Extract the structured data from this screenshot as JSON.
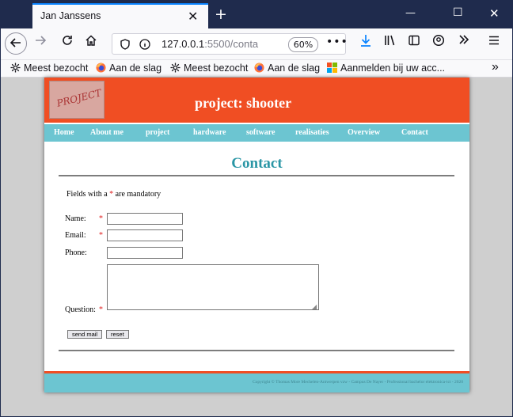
{
  "browser": {
    "tab_title": "Jan Janssens",
    "tab_close": "✕",
    "new_tab": "+",
    "window_controls": {
      "minimize": "—",
      "maximize": "☐",
      "close": "✕"
    },
    "url_host": "127.0.0.1",
    "url_rest": ":5500/conta",
    "zoom": "60%",
    "page_actions": "•••",
    "bookmarks": [
      {
        "label": "Meest bezocht",
        "icon": "gear-icon"
      },
      {
        "label": "Aan de slag",
        "icon": "firefox-icon"
      },
      {
        "label": "Meest bezocht",
        "icon": "gear-icon"
      },
      {
        "label": "Aan de slag",
        "icon": "firefox-icon"
      },
      {
        "label": "Aanmelden bij uw acc...",
        "icon": "microsoft-icon"
      }
    ],
    "overflow_label": "»"
  },
  "site": {
    "logo_text": "PROJECT",
    "title": "project: shooter",
    "menu": [
      "Home",
      "About me",
      "project",
      "hardware",
      "software",
      "realisaties",
      "Overview",
      "Contact"
    ],
    "page_title": "Contact",
    "mandatory_prefix": "Fields with a ",
    "mandatory_star": "*",
    "mandatory_suffix": " are mandatory",
    "form": {
      "name_label": "Name:",
      "email_label": "Email:",
      "phone_label": "Phone:",
      "question_label": "Question:",
      "required_marker": "*",
      "name_value": "",
      "email_value": "",
      "phone_value": "",
      "question_value": "",
      "send_label": "send mail",
      "reset_label": "reset"
    },
    "footer": "Copyright © Thomas More Mechelen-Antwerpen vzw - Campus De Nayer - Professional bachelor elektronica-ict - 2020"
  },
  "colors": {
    "header": "#f04e23",
    "menu": "#6cc5d1",
    "title": "#2a96a5",
    "required": "#e02020"
  }
}
